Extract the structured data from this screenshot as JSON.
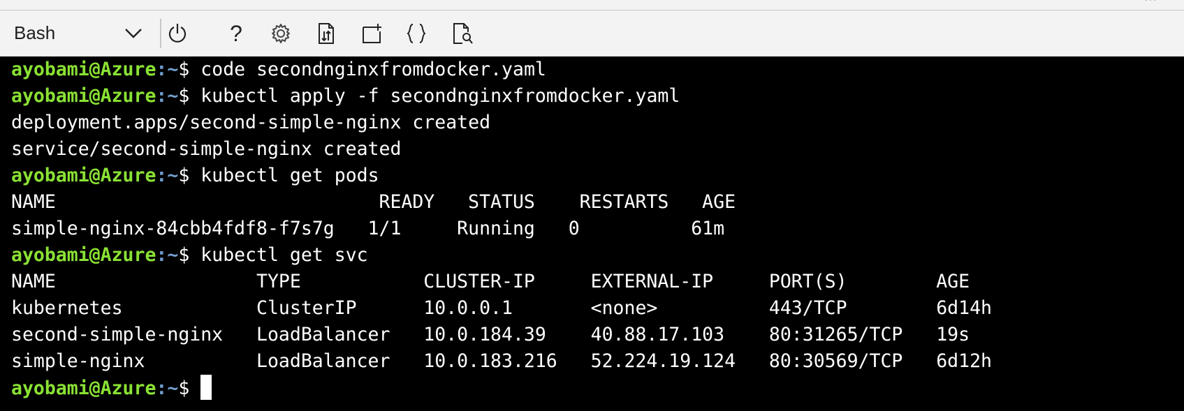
{
  "toolbar": {
    "shell_label": "Bash",
    "icons": [
      "chevron-down-icon",
      "power-icon",
      "help-icon",
      "gear-icon",
      "upload-download-icon",
      "new-session-icon",
      "editor-braces-icon",
      "web-preview-icon"
    ],
    "help_glyph": "?"
  },
  "prompt": {
    "user": "ayobami@Azure",
    "sep": ":",
    "path": "~",
    "dollar": "$ "
  },
  "terminal": {
    "lines": [
      {
        "type": "cmd",
        "text": "code secondnginxfromdocker.yaml"
      },
      {
        "type": "cmd",
        "text": "kubectl apply -f secondnginxfromdocker.yaml"
      },
      {
        "type": "out",
        "text": "deployment.apps/second-simple-nginx created"
      },
      {
        "type": "out",
        "text": "service/second-simple-nginx created"
      },
      {
        "type": "cmd",
        "text": "kubectl get pods"
      },
      {
        "type": "out",
        "text": "NAME                             READY   STATUS    RESTARTS   AGE"
      },
      {
        "type": "out",
        "text": "simple-nginx-84cbb4fdf8-f7s7g   1/1     Running   0          61m"
      },
      {
        "type": "cmd",
        "text": "kubectl get svc"
      },
      {
        "type": "out",
        "text": "NAME                  TYPE           CLUSTER-IP     EXTERNAL-IP     PORT(S)        AGE"
      },
      {
        "type": "out",
        "text": "kubernetes            ClusterIP      10.0.0.1       <none>          443/TCP        6d14h"
      },
      {
        "type": "out",
        "text": "second-simple-nginx   LoadBalancer   10.0.184.39    40.88.17.103    80:31265/TCP   19s"
      },
      {
        "type": "out",
        "text": "simple-nginx          LoadBalancer   10.0.183.216   52.224.19.124   80:30569/TCP   6d12h"
      },
      {
        "type": "cmd",
        "text": ""
      }
    ]
  },
  "colors": {
    "prompt_user": "#8ae234",
    "prompt_path": "#729fcf",
    "terminal_bg": "#000000",
    "terminal_fg": "#ffffff",
    "toolbar_bg": "#f3f3f3"
  }
}
